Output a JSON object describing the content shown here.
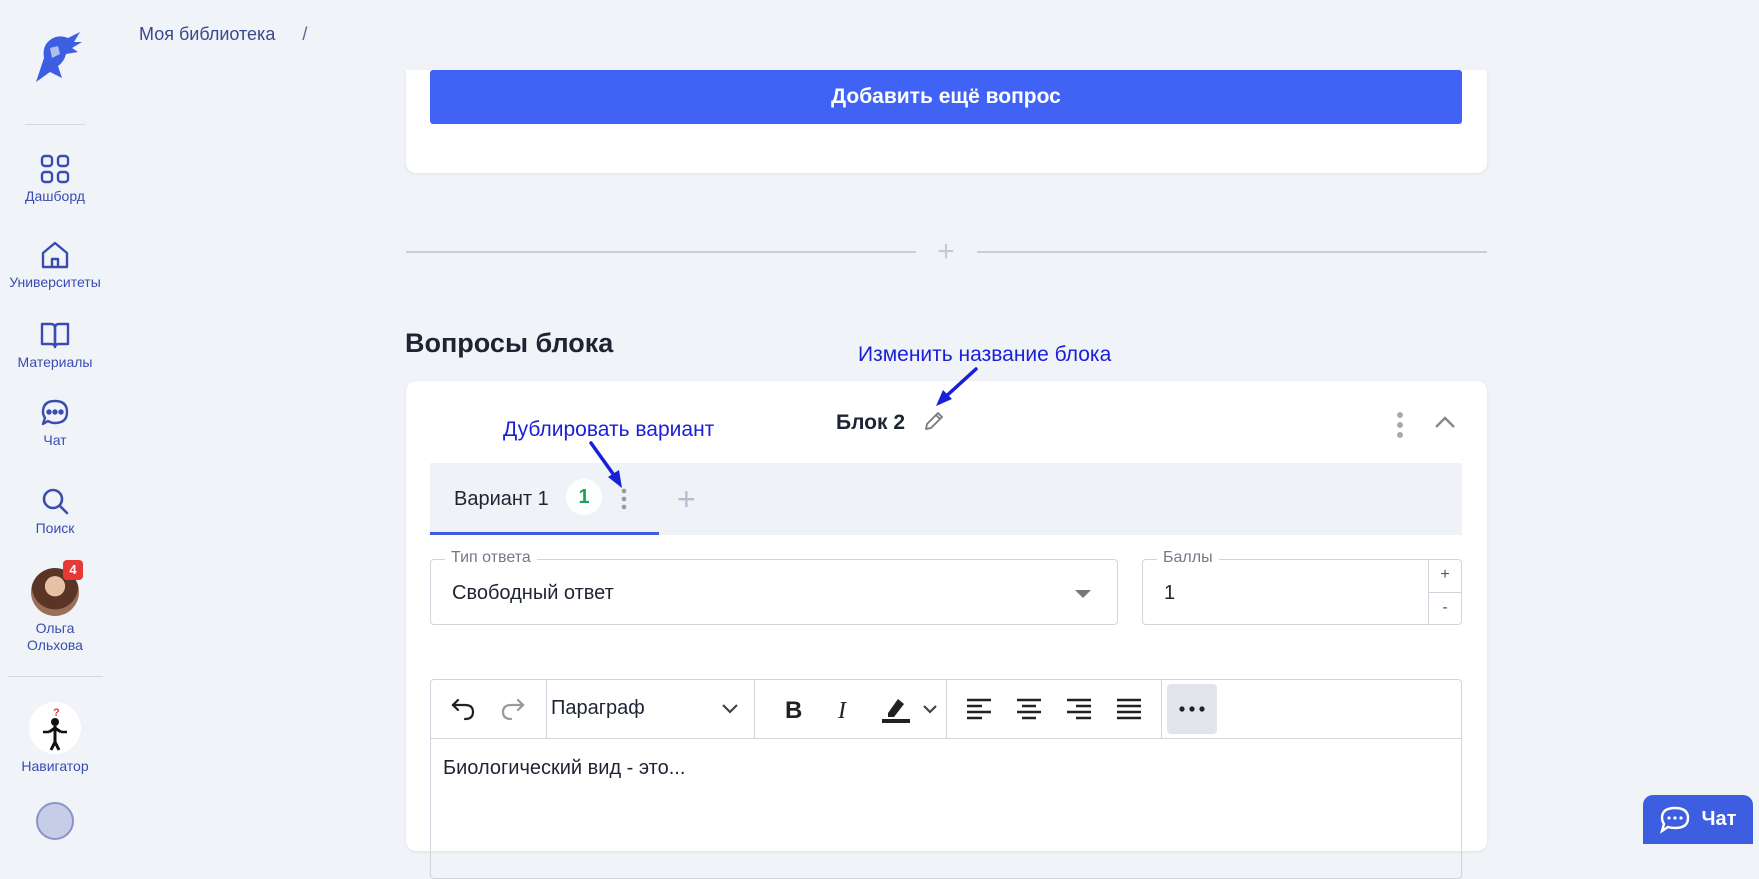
{
  "breadcrumb": {
    "root": "Моя библиотека",
    "separator": "/"
  },
  "sidebar": {
    "items": [
      {
        "label": "Дашборд",
        "icon": "grid-icon"
      },
      {
        "label": "Университеты",
        "icon": "home-icon"
      },
      {
        "label": "Материалы",
        "icon": "book-icon"
      },
      {
        "label": "Чат",
        "icon": "chat-icon"
      },
      {
        "label": "Поиск",
        "icon": "search-icon"
      }
    ],
    "user": {
      "name_first": "Ольга",
      "name_last": "Ольхова",
      "badge": "4"
    },
    "navigator": {
      "label": "Навигатор"
    }
  },
  "top_card": {
    "add_question_label": "Добавить ещё вопрос"
  },
  "section": {
    "title": "Вопросы блока"
  },
  "block": {
    "title": "Блок 2",
    "tabs": [
      {
        "label": "Вариант 1",
        "count": "1"
      }
    ],
    "answer_type": {
      "legend": "Тип ответа",
      "value": "Свободный ответ"
    },
    "points": {
      "legend": "Баллы",
      "value": "1",
      "plus": "+",
      "minus": "-"
    },
    "editor": {
      "paragraph_label": "Параграф",
      "content": "Биологический вид - это..."
    }
  },
  "annotations": {
    "rename_block": "Изменить название блока",
    "duplicate_variant": "Дублировать вариант"
  },
  "chat_button": {
    "label": "Чат"
  },
  "colors": {
    "primary": "#4063f5",
    "annotation": "#1a1fd8",
    "badge": "#e53935",
    "count": "#1aa35a"
  }
}
